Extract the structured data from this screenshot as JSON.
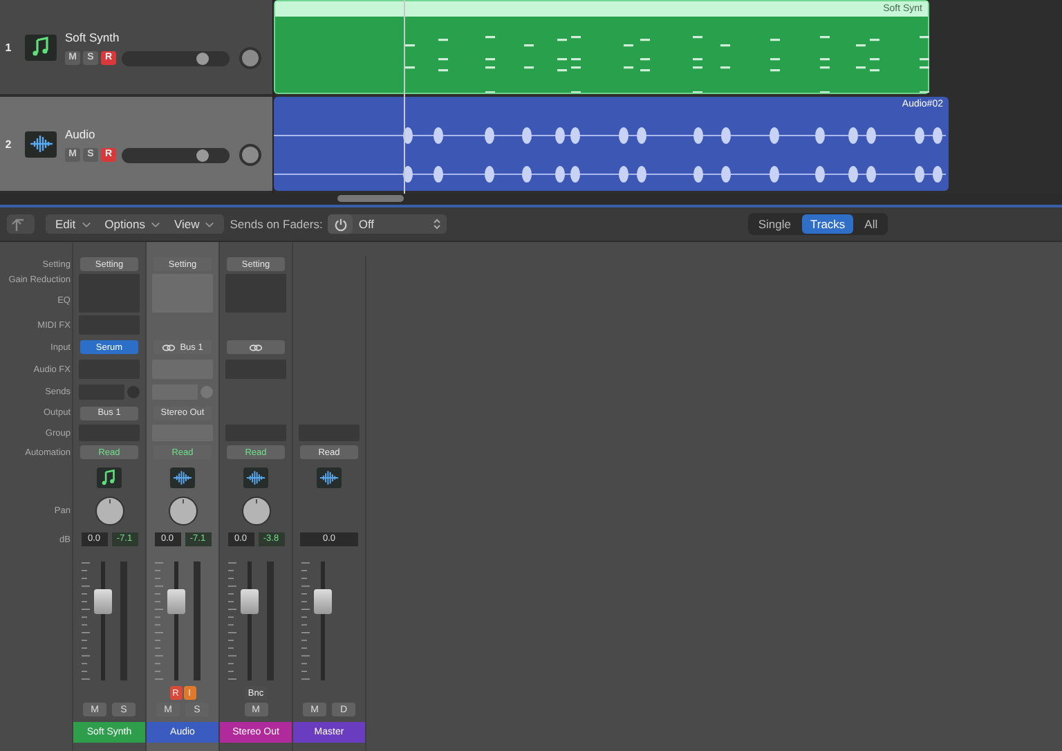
{
  "tracks": [
    {
      "number": "1",
      "name": "Soft Synth",
      "kind": "instrument",
      "selected": false,
      "buttons": [
        {
          "label": "M",
          "kind": "mute",
          "on": false
        },
        {
          "label": "S",
          "kind": "solo",
          "on": false
        },
        {
          "label": "R",
          "kind": "record",
          "on": true
        }
      ],
      "level": 0.77
    },
    {
      "number": "2",
      "name": "Audio",
      "kind": "audio",
      "selected": true,
      "buttons": [
        {
          "label": "M",
          "kind": "mute",
          "on": false
        },
        {
          "label": "S",
          "kind": "solo",
          "on": false
        },
        {
          "label": "R",
          "kind": "record",
          "on": true
        }
      ],
      "level": 0.77
    }
  ],
  "regions": [
    {
      "name": "Soft Synt",
      "kind": "midi"
    },
    {
      "name": "Audio#02",
      "kind": "audio"
    }
  ],
  "toolbar": {
    "menus": [
      "Edit",
      "Options",
      "View"
    ],
    "sends_on_faders_label": "Sends on Faders:",
    "sends_on_faders_value": "Off",
    "views": [
      {
        "label": "Single",
        "selected": false
      },
      {
        "label": "Tracks",
        "selected": true
      },
      {
        "label": "All",
        "selected": false
      }
    ]
  },
  "mixer": {
    "row_labels": [
      "Setting",
      "Gain Reduction",
      "EQ",
      "MIDI FX",
      "Input",
      "Audio FX",
      "Sends",
      "Output",
      "Group",
      "Automation",
      "Pan",
      "dB"
    ],
    "strips": [
      {
        "name": "Soft Synth",
        "kind": "instrument",
        "color": "#2e9e4c",
        "selected": false,
        "setting": "Setting",
        "input": "Serum",
        "input_highlighted": true,
        "input_link": false,
        "output": "Bus 1",
        "automation": "Read",
        "automation_active": true,
        "volume": "0.0",
        "peak": "-7.1",
        "level": 0.72,
        "buttons": [
          "M",
          "S"
        ]
      },
      {
        "name": "Audio",
        "kind": "audio",
        "color": "#3a5cc0",
        "selected": true,
        "setting": "Setting",
        "input": "Bus 1",
        "input_highlighted": false,
        "input_link": true,
        "output": "Stereo Out",
        "automation": "Read",
        "automation_active": true,
        "volume": "0.0",
        "peak": "-7.1",
        "level": 0.72,
        "extra_buttons": [
          {
            "label": "R",
            "kind": "record"
          },
          {
            "label": "I",
            "kind": "input"
          }
        ],
        "buttons": [
          "M",
          "S"
        ]
      },
      {
        "name": "Stereo Out",
        "kind": "output",
        "color": "#b02a9c",
        "selected": false,
        "setting": "Setting",
        "input_highlighted": false,
        "input_link": true,
        "automation": "Read",
        "automation_active": true,
        "volume": "0.0",
        "peak": "-3.8",
        "level": 0.72,
        "extra_buttons": [
          {
            "label": "Bnc",
            "kind": "bounce"
          }
        ],
        "buttons": [
          "M"
        ]
      },
      {
        "name": "Master",
        "kind": "master",
        "color": "#6a3cc0",
        "selected": false,
        "automation": "Read",
        "automation_active": false,
        "volume": "0.0",
        "level": 0.72,
        "buttons": [
          "M",
          "D"
        ]
      }
    ]
  }
}
